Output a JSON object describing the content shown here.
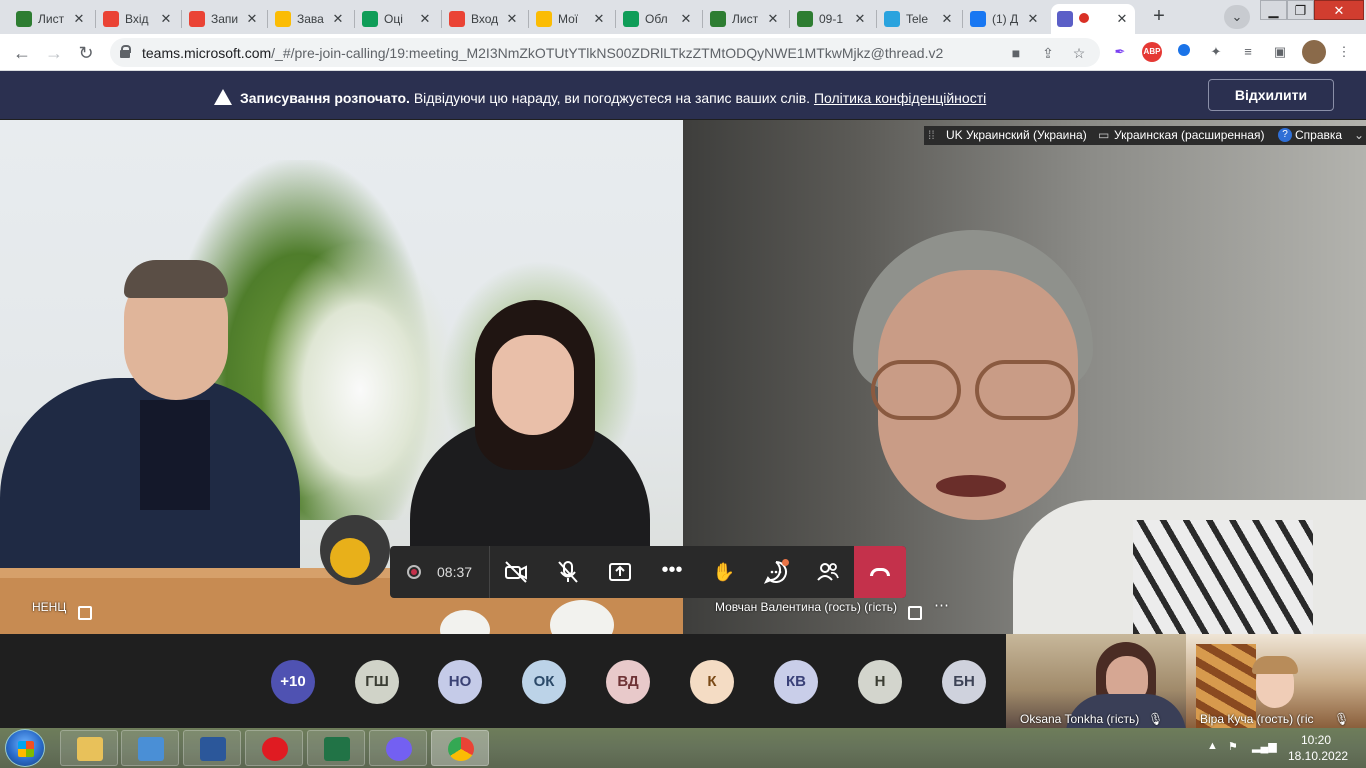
{
  "tabs": [
    {
      "label": "Лист",
      "fav": "listv",
      "color": "#2e7d32"
    },
    {
      "label": "Вхід",
      "fav": "gmail-icon",
      "color": "#ea4335"
    },
    {
      "label": "Запи",
      "fav": "gmail-icon",
      "color": "#ea4335"
    },
    {
      "label": "Зава",
      "fav": "drive-icon",
      "color": "#fbbc04"
    },
    {
      "label": "Оці",
      "fav": "sheets-icon",
      "color": "#0f9d58"
    },
    {
      "label": "Вход",
      "fav": "gmail-icon",
      "color": "#ea4335"
    },
    {
      "label": "Мої",
      "fav": "drive-icon",
      "color": "#fbbc04"
    },
    {
      "label": "Обл",
      "fav": "sheets-icon",
      "color": "#0f9d58"
    },
    {
      "label": "Лист",
      "fav": "site-icon",
      "color": "#2e7d32"
    },
    {
      "label": "09-1",
      "fav": "site-icon",
      "color": "#2e7d32"
    },
    {
      "label": "Tele",
      "fav": "telegram-icon",
      "color": "#2aa3de"
    },
    {
      "label": "(1) Д",
      "fav": "facebook-icon",
      "color": "#1877f2"
    },
    {
      "label": "",
      "fav": "teams-icon",
      "color": "#5b5fc7"
    }
  ],
  "address": {
    "url_host": "teams.microsoft.com",
    "url_path": "/_#/pre-join-calling/19:meeting_M2I3NmZkOTUtYTlkNS00ZDRlLTkzZTMtODQyNWE1MTkwMjkz@thread.v2"
  },
  "banner": {
    "title": "Записування розпочато.",
    "message": " Відвідуючи цю нараду, ви погоджуєтеся на запис ваших слів. ",
    "link": "Політика конфіденційності",
    "dismiss": "Відхилити"
  },
  "langbar": {
    "lang": "UK Украинский (Украина)",
    "layout": "Украинская (расширенная)",
    "help": "Справка"
  },
  "stage": {
    "left_label": "НЕНЦ",
    "right_label": "Мовчан Валентина (гость) (гість)"
  },
  "controls": {
    "timer": "08:37"
  },
  "participants": [
    {
      "initials": "+10",
      "bg": "#4f52b2",
      "fg": "#ffffff"
    },
    {
      "initials": "ГШ",
      "bg": "#d0d3c8",
      "fg": "#3a3d33"
    },
    {
      "initials": "НО",
      "bg": "#c5cbe8",
      "fg": "#3b4274"
    },
    {
      "initials": "ОК",
      "bg": "#bcd3e8",
      "fg": "#2c4a69"
    },
    {
      "initials": "ВД",
      "bg": "#e8c9ca",
      "fg": "#6e3336"
    },
    {
      "initials": "К",
      "bg": "#f4dcc4",
      "fg": "#7a4a17"
    },
    {
      "initials": "КВ",
      "bg": "#c9cee9",
      "fg": "#3a4178"
    },
    {
      "initials": "Н",
      "bg": "#d3d5cd",
      "fg": "#3b3d33"
    },
    {
      "initials": "БН",
      "bg": "#cfd2dd",
      "fg": "#3d4356"
    }
  ],
  "thumbs": [
    {
      "caption": "Oksana Tonkha (гість)"
    },
    {
      "caption": "Віра Куча (гость) (гіс"
    }
  ],
  "clock": {
    "time": "10:20",
    "date": "18.10.2022"
  }
}
